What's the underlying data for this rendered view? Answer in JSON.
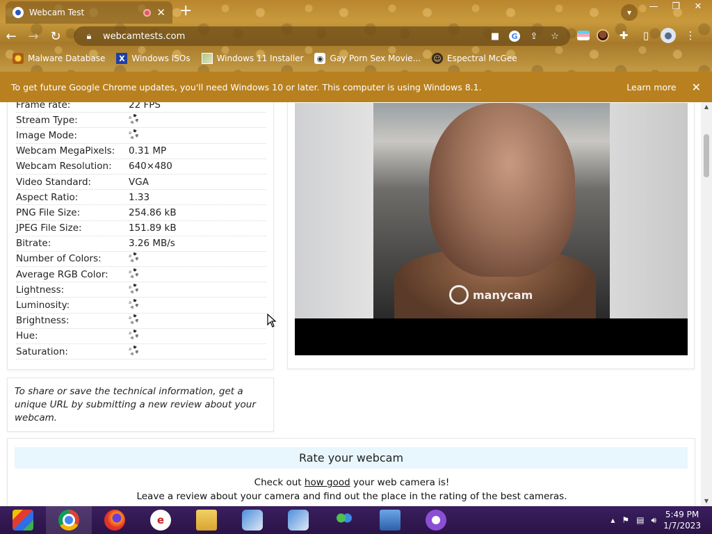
{
  "browser": {
    "tab_title": "Webcam Test",
    "tab_close": "✕",
    "new_tab": "+",
    "url": "webcamtests.com",
    "window_controls": [
      "—",
      "❐",
      "✕"
    ]
  },
  "bookmarks": [
    {
      "label": "Malware Database",
      "icon": "malware-icon"
    },
    {
      "label": "Windows ISOs",
      "icon": "x-icon"
    },
    {
      "label": "Windows 11 Installer",
      "icon": "windows-installer-icon"
    },
    {
      "label": "Gay Porn Sex Movie...",
      "icon": "site-icon"
    },
    {
      "label": "Espectral McGee",
      "icon": "profile-icon"
    }
  ],
  "infobar": {
    "message": "To get future Google Chrome updates, you'll need Windows 10 or later. This computer is using Windows 8.1.",
    "learn_more": "Learn more",
    "close": "✕"
  },
  "info_table": {
    "rows": [
      {
        "label": "Frame rate:",
        "value": "22 FPS"
      },
      {
        "label": "Stream Type:",
        "value": "",
        "loading": true
      },
      {
        "label": "Image Mode:",
        "value": "",
        "loading": true
      },
      {
        "label": "Webcam MegaPixels:",
        "value": "0.31 MP"
      },
      {
        "label": "Webcam Resolution:",
        "value": "640×480"
      },
      {
        "label": "Video Standard:",
        "value": "VGA"
      },
      {
        "label": "Aspect Ratio:",
        "value": "1.33"
      },
      {
        "label": "PNG File Size:",
        "value": "254.86 kB"
      },
      {
        "label": "JPEG File Size:",
        "value": "151.89 kB"
      },
      {
        "label": "Bitrate:",
        "value": "3.26 MB/s"
      },
      {
        "label": "Number of Colors:",
        "value": "",
        "loading": true
      },
      {
        "label": "Average RGB Color:",
        "value": "",
        "loading": true
      },
      {
        "label": "Lightness:",
        "value": "",
        "loading": true
      },
      {
        "label": "Luminosity:",
        "value": "",
        "loading": true
      },
      {
        "label": "Brightness:",
        "value": "",
        "loading": true
      },
      {
        "label": "Hue:",
        "value": "",
        "loading": true
      },
      {
        "label": "Saturation:",
        "value": "",
        "loading": true
      }
    ]
  },
  "video": {
    "watermark": "manycam"
  },
  "share_note": "To share or save the technical information, get a unique URL by submitting a new review about your webcam.",
  "rate": {
    "heading": "Rate your webcam",
    "line1_pre": "Check out ",
    "line1_link": "how good",
    "line1_post": " your web camera is!",
    "line2": "Leave a review about your camera and find out the place in the rating of the best cameras."
  },
  "taskbar": {
    "time": "5:49 PM",
    "date": "1/7/2023"
  }
}
